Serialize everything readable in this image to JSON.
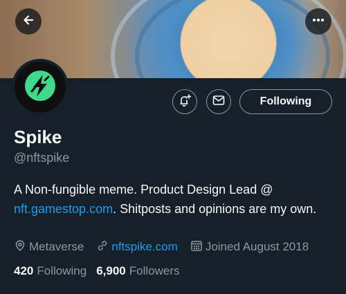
{
  "profile": {
    "name": "Spike",
    "handle": "@nftspike",
    "bio_text_1": "A Non-fungible meme. Product Design Lead @ ",
    "bio_link": "nft.gamestop.com",
    "bio_text_2": ". Shitposts and opinions are my own.",
    "location": "Metaverse",
    "website": "nftspike.com",
    "joined": "Joined August 2018",
    "following_count": "420",
    "following_label": "Following",
    "followers_count": "6,900",
    "followers_label": "Followers"
  },
  "actions": {
    "follow_state_label": "Following"
  },
  "icons": {
    "back": "arrow-left-icon",
    "more": "more-dots-icon",
    "notify": "bell-plus-icon",
    "message": "envelope-icon",
    "location": "location-pin-icon",
    "website": "link-icon",
    "joined": "calendar-icon",
    "avatar": "lightning-bolt-icon"
  },
  "colors": {
    "background": "#15202b",
    "accent": "#1d9bf0",
    "secondary_text": "#8b98a5",
    "avatar_green": "#3fd98c"
  }
}
